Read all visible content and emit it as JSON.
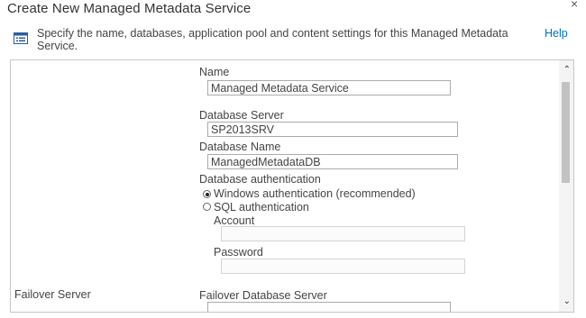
{
  "dialog": {
    "title": "Create New Managed Metadata Service",
    "close_glyph": "×",
    "description": "Specify the name, databases, application pool and content settings for this Managed Metadata Service.",
    "help_label": "Help",
    "info_icon": "info-list-icon"
  },
  "form": {
    "name": {
      "label": "Name",
      "value": "Managed Metadata Service"
    },
    "database_server": {
      "label": "Database Server",
      "value": "SP2013SRV"
    },
    "database_name": {
      "label": "Database Name",
      "value": "ManagedMetadataDB"
    },
    "database_auth": {
      "label": "Database authentication",
      "options": [
        {
          "label": "Windows authentication (recommended)",
          "selected": true
        },
        {
          "label": "SQL authentication",
          "selected": false
        }
      ],
      "account_label": "Account",
      "account_value": "",
      "password_label": "Password",
      "password_value": ""
    },
    "failover": {
      "section_label": "Failover Server",
      "label": "Failover Database Server",
      "value": ""
    }
  },
  "scrollbar": {
    "up_glyph": "⌃",
    "down_glyph": "⌄"
  }
}
